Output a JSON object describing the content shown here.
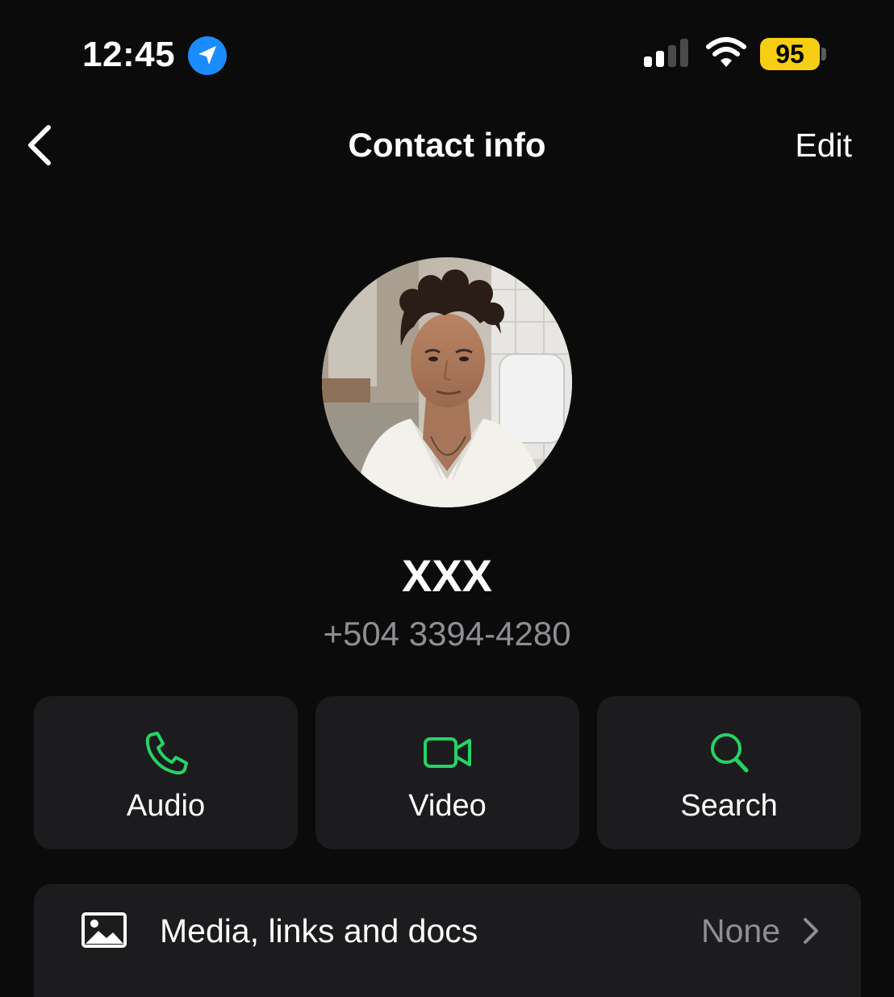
{
  "status_bar": {
    "time": "12:45",
    "battery_level": "95",
    "icons": [
      "location-arrow-icon",
      "cellular-signal-icon",
      "wifi-icon",
      "battery-icon"
    ],
    "colors": {
      "location_badge": "#1a8cff",
      "battery_fill": "#f6cf14"
    }
  },
  "nav": {
    "back_icon": "chevron-left-icon",
    "title": "Contact info",
    "edit_label": "Edit"
  },
  "contact": {
    "name": "XXX",
    "phone": "+504 3394-4280"
  },
  "actions": [
    {
      "label": "Audio",
      "icon": "phone-icon"
    },
    {
      "label": "Video",
      "icon": "video-camera-icon"
    },
    {
      "label": "Search",
      "icon": "search-icon"
    }
  ],
  "media": {
    "label": "Media, links and docs",
    "value": "None",
    "icon": "image-icon"
  },
  "colors": {
    "background": "#0b0b0b",
    "card": "#1c1c1e",
    "accent_green": "#25d366",
    "secondary_text": "#8e8e93"
  }
}
